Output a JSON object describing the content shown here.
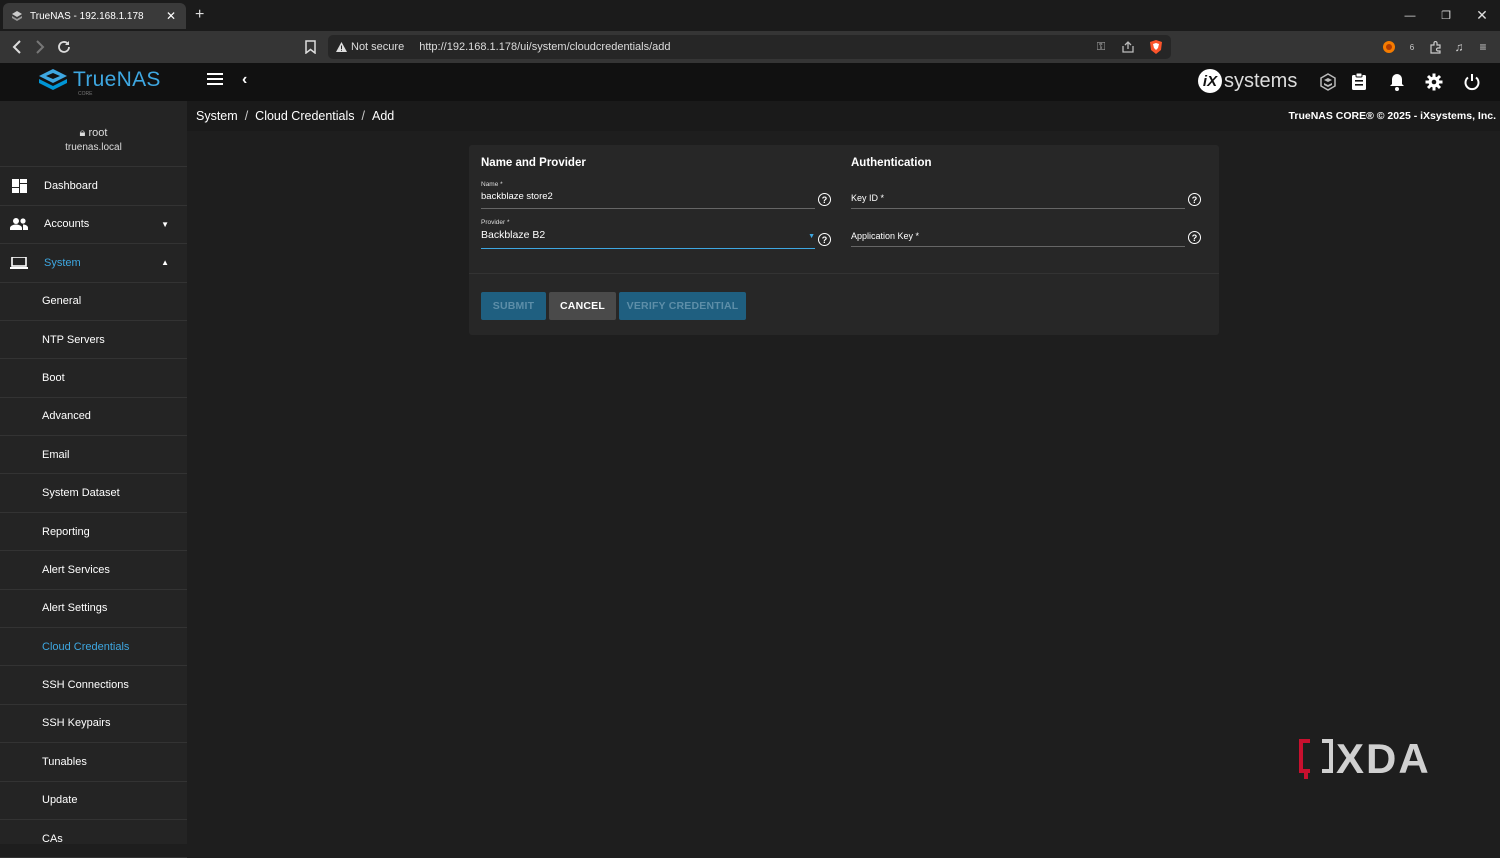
{
  "browser": {
    "tab_title": "TrueNAS - 192.168.1.178",
    "tab_close": "✕",
    "new_tab": "+",
    "security_label": "Not secure",
    "url": "http://192.168.1.178/ui/system/cloudcredentials/add",
    "extension_badge": "6"
  },
  "header": {
    "logo_text": "TrueNAS",
    "logo_sub": "CORE",
    "vendor_logo": "systems",
    "vendor_mark": "iX"
  },
  "sidebar": {
    "user": "root",
    "host": "truenas.local",
    "items": [
      {
        "label": "Dashboard",
        "icon": "dashboard-icon"
      },
      {
        "label": "Accounts",
        "icon": "people-icon"
      },
      {
        "label": "System",
        "icon": "laptop-icon"
      }
    ],
    "sub_items": [
      "General",
      "NTP Servers",
      "Boot",
      "Advanced",
      "Email",
      "System Dataset",
      "Reporting",
      "Alert Services",
      "Alert Settings",
      "Cloud Credentials",
      "SSH Connections",
      "SSH Keypairs",
      "Tunables",
      "Update",
      "CAs"
    ],
    "active_sub": "Cloud Credentials"
  },
  "breadcrumb": [
    "System",
    "Cloud Credentials",
    "Add"
  ],
  "copyright": "TrueNAS CORE® © 2025 - iXsystems, Inc.",
  "form": {
    "left_title": "Name and Provider",
    "right_title": "Authentication",
    "name_label": "Name *",
    "name_value": "backblaze store2",
    "provider_label": "Provider *",
    "provider_value": "Backblaze B2",
    "key_id_label": "Key ID *",
    "app_key_label": "Application Key *",
    "help": "?",
    "submit": "SUBMIT",
    "cancel": "CANCEL",
    "verify": "VERIFY CREDENTIAL"
  },
  "watermark": "XDA",
  "colors": {
    "accent": "#3ea7e1",
    "button_primary": "#1f5f80",
    "button_secondary": "#4a4a4a"
  }
}
